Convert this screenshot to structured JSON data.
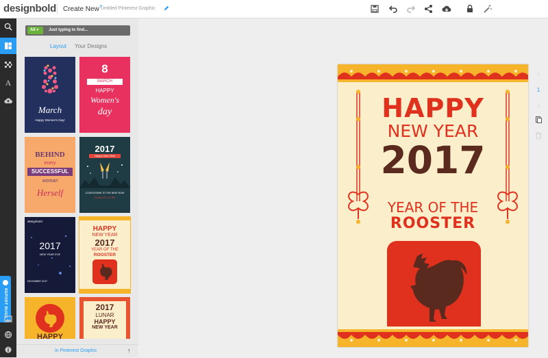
{
  "app": {
    "logo": "designbold",
    "create_new": "Create New",
    "create_plus": "+",
    "doc_title": "Untitled Pinterest Graphic"
  },
  "toolbar": {
    "icons": [
      "save-icon",
      "undo-icon",
      "redo-icon",
      "share-icon",
      "download-icon",
      "lock-icon",
      "magic-wand-icon"
    ]
  },
  "rail": {
    "items": [
      "search-icon",
      "layout-icon",
      "background-icon",
      "text-icon",
      "upload-icon",
      "image-icon",
      "globe-icon",
      "info-icon"
    ],
    "report_label": "REPORT BUGS"
  },
  "panel": {
    "filter_label": "All",
    "search_placeholder": "Just typing to find...",
    "tabs": [
      "Layout",
      "Your Designs"
    ],
    "footer_label": "in Pinterest Graphic",
    "footer_arrow": "↑",
    "thumbs": [
      {
        "big": "8",
        "title": "March",
        "sub": "Happy Women's Day!"
      },
      {
        "big": "8",
        "title": "MARCH",
        "line1": "HAPPY",
        "line2": "Women's",
        "line3": "day"
      },
      {
        "l1": "BEHIND",
        "l2": "every",
        "l3": "SUCCESSFUL",
        "l4": "woman",
        "l5": "Herself"
      },
      {
        "year": "2017",
        "sub": "Happy New Year",
        "foot1": "COUNTDOWN TO THE NEW YEAR",
        "foot2": "CLUB XYZ | 12 PM"
      },
      {
        "brand": "designbold",
        "year": "2017",
        "sub": "NEW YEAR EVE",
        "foot": "DECEMBER 31ST"
      },
      {
        "l1": "HAPPY",
        "l2": "NEW YEAR",
        "l3": "2017",
        "l4": "YEAR OF THE",
        "l5": "ROOSTER"
      },
      {
        "l1": "HAPPY"
      },
      {
        "l1": "2017",
        "l2": "LUNAR",
        "l3": "HAPPY",
        "l4": "NEW YEAR"
      }
    ]
  },
  "poster": {
    "line1": "HAPPY",
    "line2": "NEW YEAR",
    "line3": "2017",
    "line4": "YEAR OF THE",
    "line5": "ROOSTER"
  },
  "pagebar": {
    "page_number": "1"
  },
  "colors": {
    "accent": "#2a9df4",
    "poster_red": "#e0311f",
    "poster_brown": "#5b2a1e",
    "poster_bg": "#fbeecb",
    "poster_gold": "#f5b42a"
  }
}
